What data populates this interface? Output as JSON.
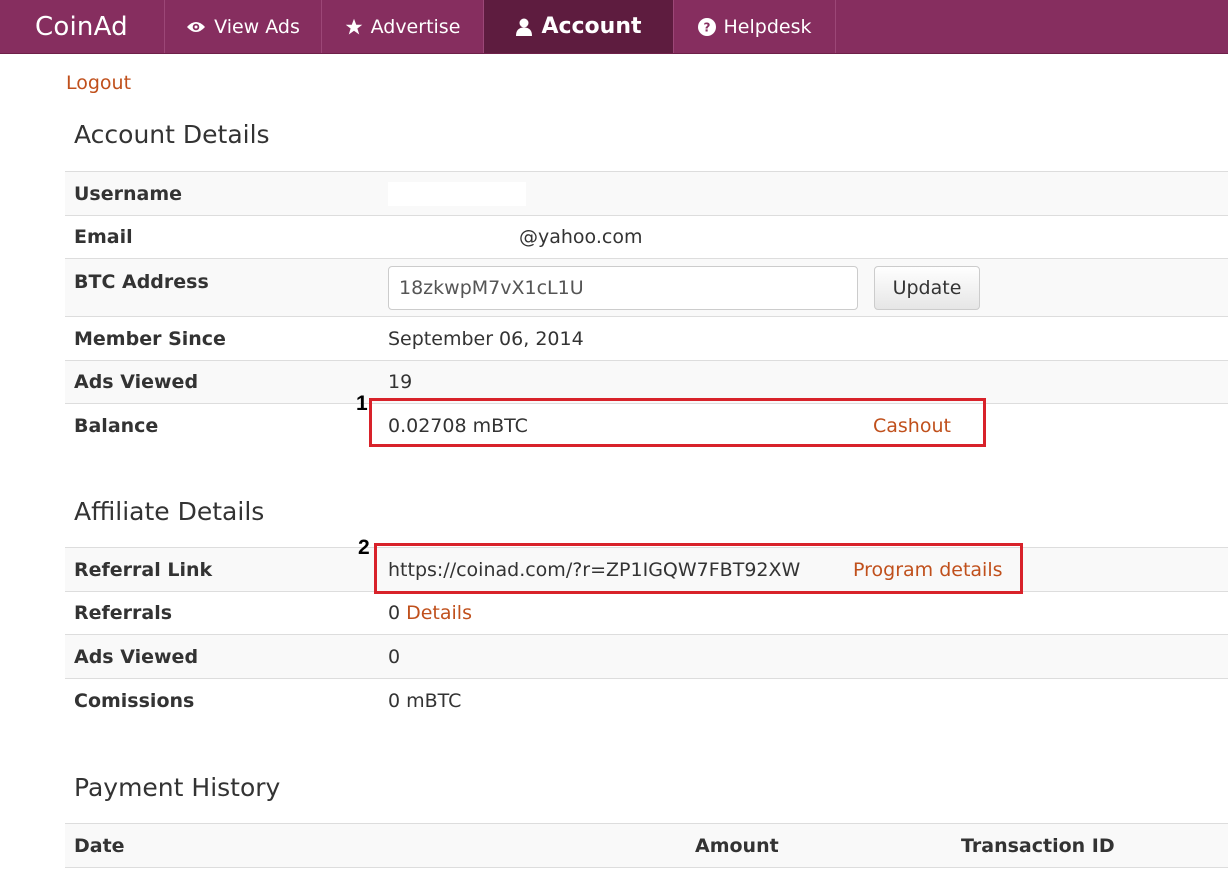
{
  "nav": {
    "brand": "CoinAd",
    "items": [
      {
        "label": "View Ads",
        "icon": "eye-icon"
      },
      {
        "label": "Advertise",
        "icon": "star-icon"
      },
      {
        "label": "Account",
        "icon": "user-icon",
        "active": true
      },
      {
        "label": "Helpdesk",
        "icon": "question-circle-icon"
      }
    ]
  },
  "logout": "Logout",
  "account": {
    "title": "Account Details",
    "username_label": "Username",
    "email_label": "Email",
    "email_value": "@yahoo.com",
    "btc_label": "BTC Address",
    "btc_value": "18zkwpM7vX1cL1U",
    "update_label": "Update",
    "member_label": "Member Since",
    "member_value": "September 06, 2014",
    "ads_label": "Ads Viewed",
    "ads_value": "19",
    "balance_label": "Balance",
    "balance_value": "0.02708 mBTC",
    "cashout_label": "Cashout"
  },
  "affiliate": {
    "title": "Affiliate Details",
    "ref_label": "Referral Link",
    "ref_value": "https://coinad.com/?r=ZP1IGQW7FBT92XW",
    "program_label": "Program details",
    "referrals_label": "Referrals",
    "referrals_value": "0",
    "details_label": "Details",
    "ads_label": "Ads Viewed",
    "ads_value": "0",
    "comm_label": "Comissions",
    "comm_value": "0 mBTC"
  },
  "annotations": [
    "1",
    "2"
  ],
  "payments": {
    "title": "Payment History",
    "columns": [
      "Date",
      "Amount",
      "Transaction ID"
    ]
  },
  "colors": {
    "navbar": "#862e5f",
    "navbar_active": "#5e1c3f",
    "link": "#c0501c",
    "annotation": "#d8222a"
  }
}
